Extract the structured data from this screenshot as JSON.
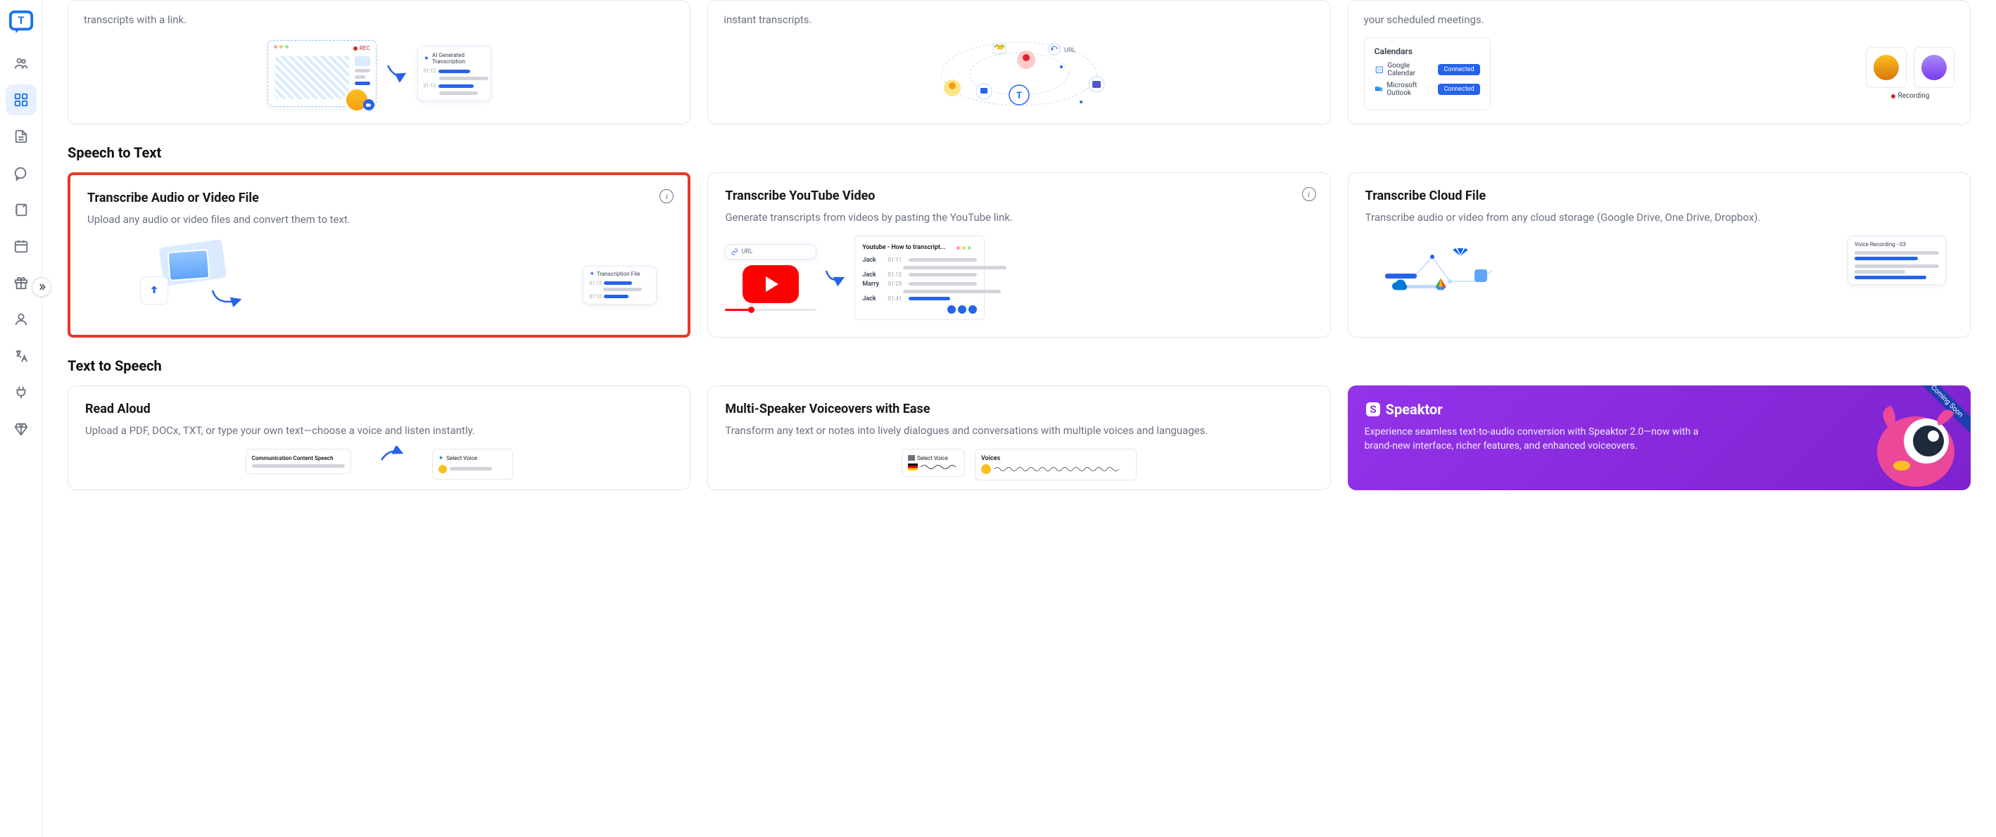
{
  "top_row": {
    "card1_desc": "transcripts with a link.",
    "card1_rec": "REC",
    "card1_ai": "AI Generated Transcription",
    "card2_desc": "instant transcripts.",
    "card2_url": "URL",
    "card3_desc": "your scheduled meetings.",
    "card3_calendars": "Calendars",
    "card3_google": "Google Calendar",
    "card3_outlook": "Microsoft Outlook",
    "card3_connected": "Connected",
    "card3_recording": "Recording"
  },
  "sections": {
    "stt": "Speech to Text",
    "tts": "Text to Speech"
  },
  "stt_cards": {
    "c1_title": "Transcribe Audio or Video File",
    "c1_desc": "Upload any audio or video files and convert them to text.",
    "c1_transfile": "Transcription File",
    "c1_t1": "01:12",
    "c1_t2": "01:12",
    "c2_title": "Transcribe YouTube Video",
    "c2_desc": "Generate transcripts from videos by pasting the YouTube link.",
    "c2_url": "URL",
    "c2_yt_title": "Youtube - How to transcript...",
    "c2_name1": "Jack",
    "c2_name2": "Jack",
    "c2_name3": "Marry",
    "c2_name4": "Jack",
    "c2_time1": "01:11",
    "c2_time2": "01:12",
    "c2_time3": "01:25",
    "c2_time4": "01:41",
    "c3_title": "Transcribe Cloud File",
    "c3_desc": "Transcribe audio or video from any cloud storage (Google Drive, One Drive, Dropbox).",
    "c3_voice": "Voice Recording - 03"
  },
  "tts_cards": {
    "c1_title": "Read Aloud",
    "c1_desc": "Upload a PDF, DOCx, TXT, or type your own text—choose a voice and listen instantly.",
    "c1_comm": "Communication Content Speech",
    "c1_select": "Select Voice",
    "c2_title": "Multi-Speaker Voiceovers with Ease",
    "c2_desc": "Transform any text or notes into lively dialogues and conversations with multiple voices and languages.",
    "c2_select": "Select Voice",
    "c2_voices": "Voices",
    "c3_brand": "Speaktor",
    "c3_desc": "Experience seamless text-to-audio conversion with Speaktor 2.0—now with a brand-new interface, richer features, and enhanced voiceovers.",
    "c3_badge": "Coming Soon"
  }
}
